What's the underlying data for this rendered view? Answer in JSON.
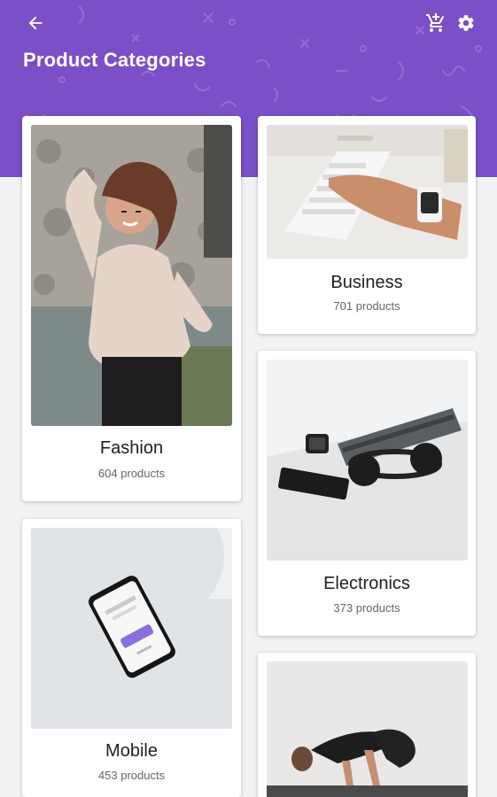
{
  "header": {
    "title": "Product Categories",
    "color": "#7b4fc8",
    "icons": {
      "back": "arrow-left-icon",
      "cart": "cart-add-icon",
      "settings": "gear-icon"
    }
  },
  "categories": [
    {
      "name": "Fashion",
      "count": "604 products",
      "image": "woman-smiling-photo"
    },
    {
      "name": "Business",
      "count": "701 products",
      "image": "hands-typing-keyboard-photo"
    },
    {
      "name": "Electronics",
      "count": "373 products",
      "image": "laptop-headphones-phone-watch-photo"
    },
    {
      "name": "Mobile",
      "count": "453 products",
      "image": "smartphone-on-table-photo"
    },
    {
      "name": "",
      "count": "",
      "image": "yoga-pose-photo"
    }
  ]
}
